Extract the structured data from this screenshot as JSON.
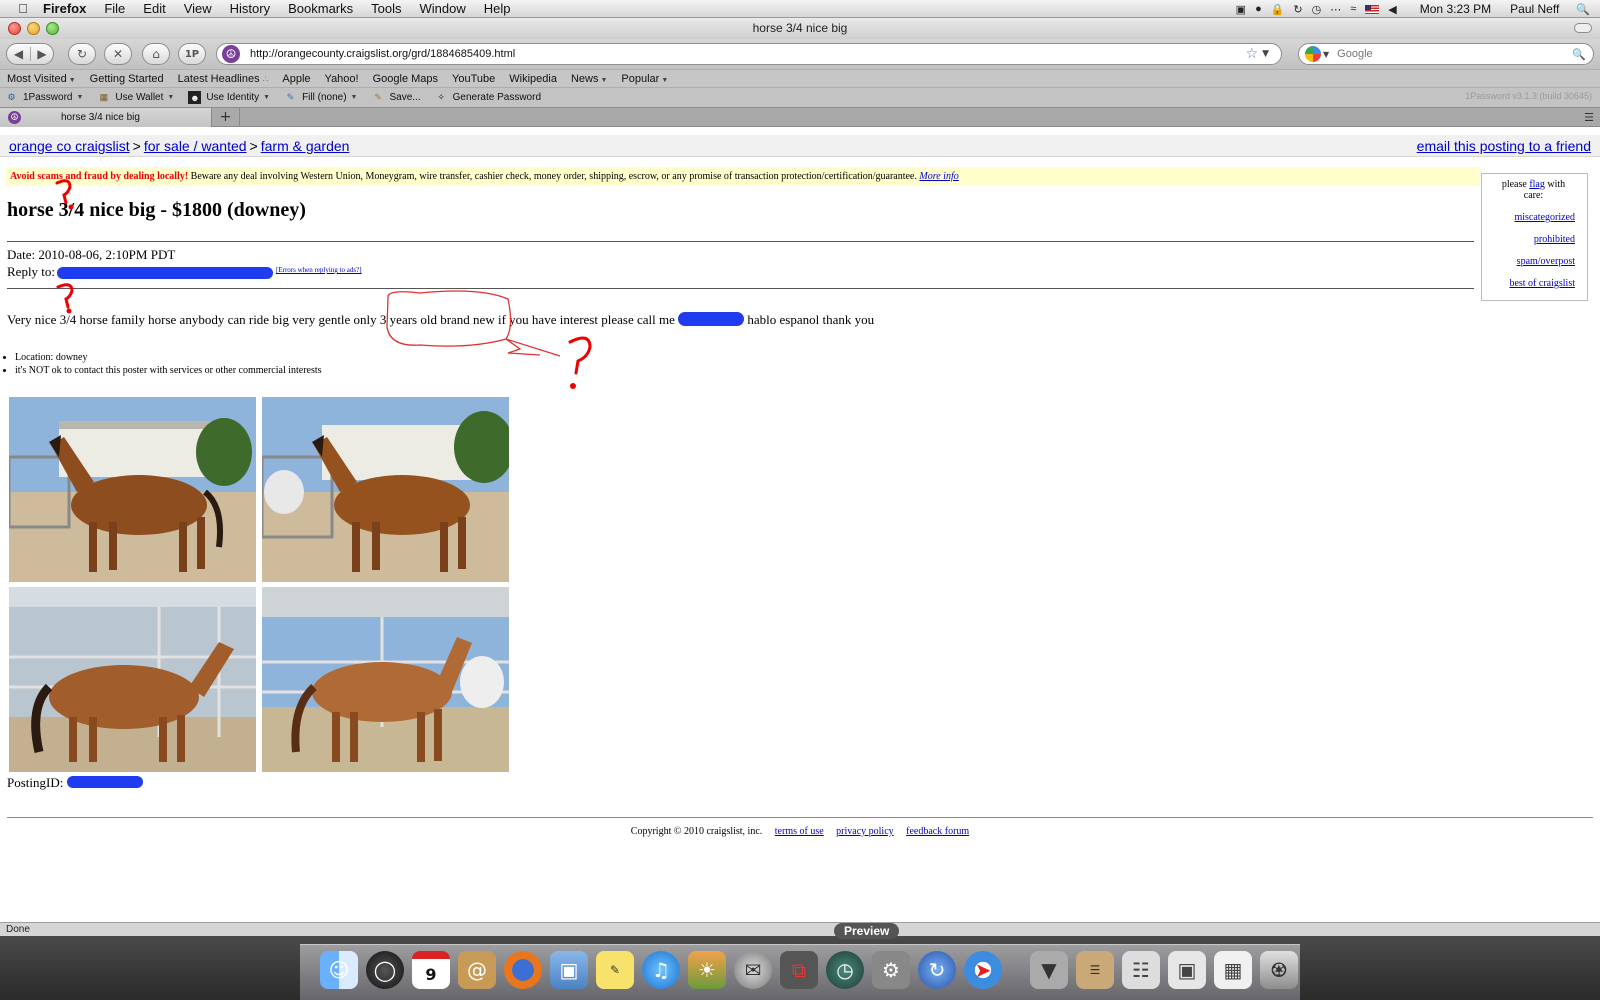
{
  "menubar": {
    "app_name": "Firefox",
    "items": [
      "File",
      "Edit",
      "View",
      "History",
      "Bookmarks",
      "Tools",
      "Window",
      "Help"
    ],
    "clock": "Mon 3:23 PM",
    "user": "Paul Neff"
  },
  "window": {
    "title": "horse 3/4 nice big"
  },
  "toolbar": {
    "onepassword_button": "1P",
    "url": "http://orangecounty.craigslist.org/grd/1884685409.html",
    "search_placeholder": "Google"
  },
  "bookmarks": [
    "Most Visited",
    "Getting Started",
    "Latest Headlines",
    "Apple",
    "Yahoo!",
    "Google Maps",
    "YouTube",
    "Wikipedia",
    "News",
    "Popular"
  ],
  "password_bar": {
    "items": [
      "1Password",
      "Use Wallet",
      "Use Identity",
      "Fill (none)",
      "Save...",
      "Generate Password"
    ],
    "version": "1Password v3.1.3 (build 30645)"
  },
  "tabs": [
    {
      "label": "horse 3/4 nice big",
      "active": true
    }
  ],
  "page": {
    "breadcrumb": [
      "orange co craigslist",
      "for sale / wanted",
      "farm & garden"
    ],
    "email_link": "email this posting to a friend",
    "scam_warning_bold": "Avoid scams and fraud by dealing locally!",
    "scam_warning_text": "Beware any deal involving Western Union, Moneygram, wire transfer, cashier check, money order, shipping, escrow, or any promise of transaction protection/certification/guarantee.",
    "scam_more_info": "More info",
    "flag_box": {
      "prefix": "please",
      "flag_link": "flag",
      "suffix": "with care:",
      "links": [
        "miscategorized",
        "prohibited",
        "spam/overpost",
        "best of craigslist"
      ]
    },
    "title": "horse 3/4 nice big - $1800 (downey)",
    "date": "Date: 2010-08-06, 2:10PM PDT",
    "reply_label": "Reply to:",
    "reply_errors_link": "[Errors when replying to ads?]",
    "body_part1": "Very nice 3/4 horse family horse anybody can ride big very gentle only",
    "body_highlight": "3 years old brand new",
    "body_part2": "if you have interest please call me",
    "body_part3": "hablo espanol thank you",
    "attributes": [
      "Location: downey",
      "it's NOT ok to contact this poster with services or other commercial interests"
    ],
    "posting_id_label": "PostingID:",
    "footer_copyright": "Copyright © 2010 craigslist, inc.",
    "footer_links": [
      "terms of use",
      "privacy policy",
      "feedback forum"
    ]
  },
  "statusbar": {
    "text": "Done"
  },
  "dock": {
    "tooltip": "Preview"
  }
}
